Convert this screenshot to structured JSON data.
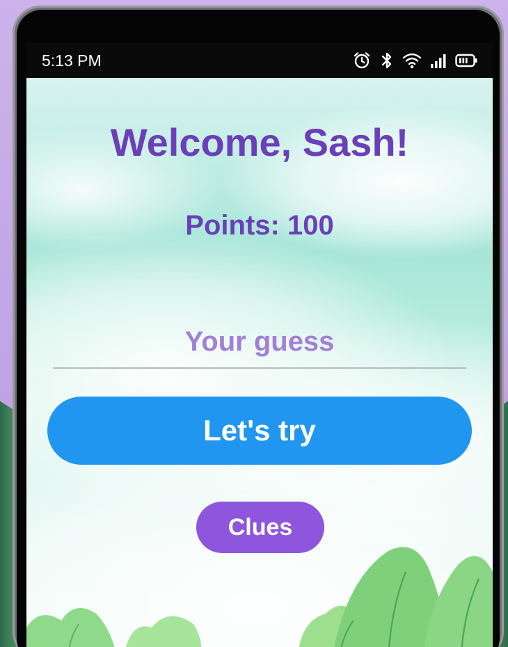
{
  "status_bar": {
    "time": "5:13 PM",
    "icons": [
      "alarm-icon",
      "bluetooth-icon",
      "wifi-icon",
      "signal-icon",
      "battery-icon"
    ]
  },
  "game": {
    "welcome_text": "Welcome, Sash!",
    "points_text": "Points: 100",
    "guess_placeholder": "Your guess",
    "guess_value": "",
    "try_button_label": "Let's try",
    "clues_button_label": "Clues"
  },
  "colors": {
    "heading": "#6a3fb8",
    "placeholder": "#a37fd6",
    "primary_button": "#2196f0",
    "secondary_button": "#8e56dc"
  }
}
